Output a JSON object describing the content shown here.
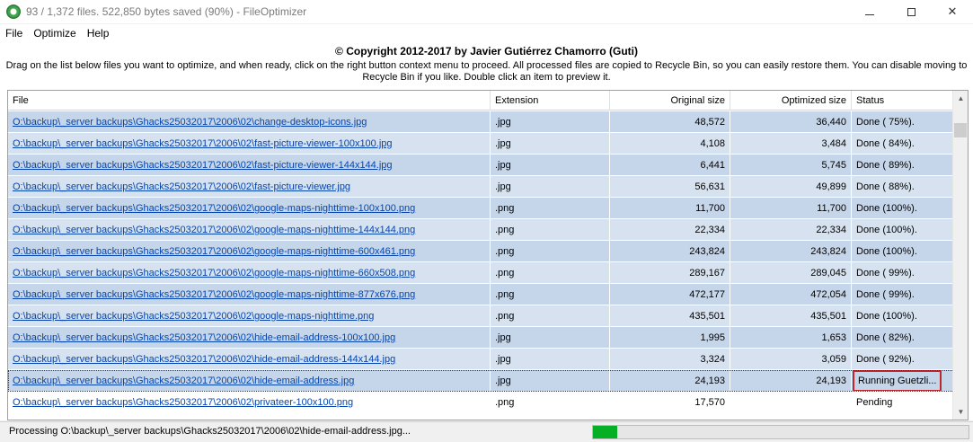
{
  "window": {
    "title": "93 / 1,372 files. 522,850 bytes saved (90%) - FileOptimizer",
    "minimize_glyph": "",
    "maximize_glyph": "",
    "close_glyph": "✕"
  },
  "menu": [
    "File",
    "Optimize",
    "Help"
  ],
  "copyright": "© Copyright 2012-2017 by Javier Gutiérrez Chamorro (Guti)",
  "instructions": "Drag on the list below files you want to optimize, and when ready, click on the right button context menu to proceed. All processed files are copied to Recycle Bin, so you can easily restore them. You can disable moving to Recycle Bin if you like. Double click an item to preview it.",
  "columns": {
    "file": "File",
    "extension": "Extension",
    "original_size": "Original size",
    "optimized_size": "Optimized size",
    "status": "Status"
  },
  "rows": [
    {
      "file": "O:\\backup\\_server backups\\Ghacks25032017\\2006\\02\\change-desktop-icons.jpg",
      "ext": ".jpg",
      "orig": "48,572",
      "opt": "36,440",
      "status": "Done ( 75%)."
    },
    {
      "file": "O:\\backup\\_server backups\\Ghacks25032017\\2006\\02\\fast-picture-viewer-100x100.jpg",
      "ext": ".jpg",
      "orig": "4,108",
      "opt": "3,484",
      "status": "Done ( 84%)."
    },
    {
      "file": "O:\\backup\\_server backups\\Ghacks25032017\\2006\\02\\fast-picture-viewer-144x144.jpg",
      "ext": ".jpg",
      "orig": "6,441",
      "opt": "5,745",
      "status": "Done ( 89%)."
    },
    {
      "file": "O:\\backup\\_server backups\\Ghacks25032017\\2006\\02\\fast-picture-viewer.jpg",
      "ext": ".jpg",
      "orig": "56,631",
      "opt": "49,899",
      "status": "Done ( 88%)."
    },
    {
      "file": "O:\\backup\\_server backups\\Ghacks25032017\\2006\\02\\google-maps-nighttime-100x100.png",
      "ext": ".png",
      "orig": "11,700",
      "opt": "11,700",
      "status": "Done (100%)."
    },
    {
      "file": "O:\\backup\\_server backups\\Ghacks25032017\\2006\\02\\google-maps-nighttime-144x144.png",
      "ext": ".png",
      "orig": "22,334",
      "opt": "22,334",
      "status": "Done (100%)."
    },
    {
      "file": "O:\\backup\\_server backups\\Ghacks25032017\\2006\\02\\google-maps-nighttime-600x461.png",
      "ext": ".png",
      "orig": "243,824",
      "opt": "243,824",
      "status": "Done (100%)."
    },
    {
      "file": "O:\\backup\\_server backups\\Ghacks25032017\\2006\\02\\google-maps-nighttime-660x508.png",
      "ext": ".png",
      "orig": "289,167",
      "opt": "289,045",
      "status": "Done ( 99%)."
    },
    {
      "file": "O:\\backup\\_server backups\\Ghacks25032017\\2006\\02\\google-maps-nighttime-877x676.png",
      "ext": ".png",
      "orig": "472,177",
      "opt": "472,054",
      "status": "Done ( 99%)."
    },
    {
      "file": "O:\\backup\\_server backups\\Ghacks25032017\\2006\\02\\google-maps-nighttime.png",
      "ext": ".png",
      "orig": "435,501",
      "opt": "435,501",
      "status": "Done (100%)."
    },
    {
      "file": "O:\\backup\\_server backups\\Ghacks25032017\\2006\\02\\hide-email-address-100x100.jpg",
      "ext": ".jpg",
      "orig": "1,995",
      "opt": "1,653",
      "status": "Done ( 82%)."
    },
    {
      "file": "O:\\backup\\_server backups\\Ghacks25032017\\2006\\02\\hide-email-address-144x144.jpg",
      "ext": ".jpg",
      "orig": "3,324",
      "opt": "3,059",
      "status": "Done ( 92%)."
    },
    {
      "file": "O:\\backup\\_server backups\\Ghacks25032017\\2006\\02\\hide-email-address.jpg",
      "ext": ".jpg",
      "orig": "24,193",
      "opt": "24,193",
      "status": "Running Guetzli..."
    },
    {
      "file": "O:\\backup\\_server backups\\Ghacks25032017\\2006\\02\\privateer-100x100.png",
      "ext": ".png",
      "orig": "17,570",
      "opt": "",
      "status": "Pending"
    }
  ],
  "statusbar": {
    "text": "Processing O:\\backup\\_server backups\\Ghacks25032017\\2006\\02\\hide-email-address.jpg...",
    "progress_fraction": 0.065
  },
  "colors": {
    "progress": "#06b025",
    "highlight_border": "#c0272d",
    "link": "#0645ad"
  }
}
